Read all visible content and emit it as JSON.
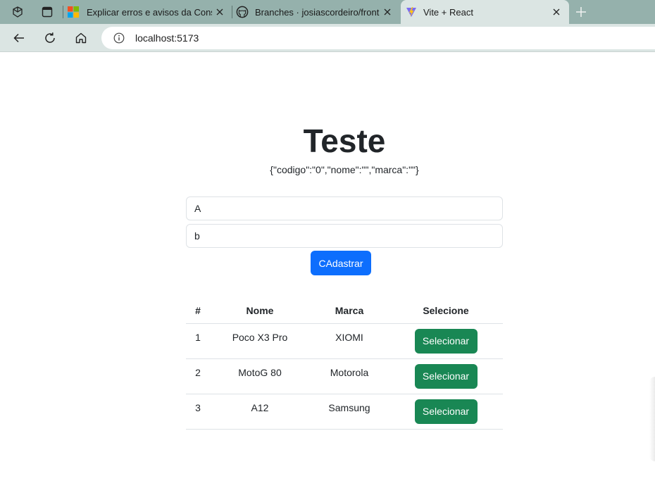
{
  "browser": {
    "tabs": [
      {
        "label": "Explicar erros e avisos da Consola",
        "icon": "microsoft-logo-icon"
      },
      {
        "label": "Branches · josiascordeiro/front",
        "icon": "github-icon"
      },
      {
        "label": "Vite + React",
        "icon": "vite-logo-icon"
      }
    ],
    "url": "localhost:5173",
    "colors": {
      "chrome": "#95b1ac",
      "toolbar": "#dbe5e3"
    }
  },
  "page": {
    "title": "Teste",
    "json_state": "{\"codigo\":\"0\",\"nome\":\"\",\"marca\":\"\"}",
    "form": {
      "nome_value": "A",
      "marca_value": "b",
      "submit_label": "CAdastrar"
    },
    "table": {
      "headers": [
        "#",
        "Nome",
        "Marca",
        "Selecione"
      ],
      "rows": [
        {
          "id": "1",
          "nome": "Poco X3 Pro",
          "marca": "XIOMI",
          "action": "Selecionar"
        },
        {
          "id": "2",
          "nome": "MotoG 80",
          "marca": "Motorola",
          "action": "Selecionar"
        },
        {
          "id": "3",
          "nome": "A12",
          "marca": "Samsung",
          "action": "Selecionar"
        }
      ]
    },
    "colors": {
      "primary": "#0d6efd",
      "success": "#198754"
    }
  }
}
